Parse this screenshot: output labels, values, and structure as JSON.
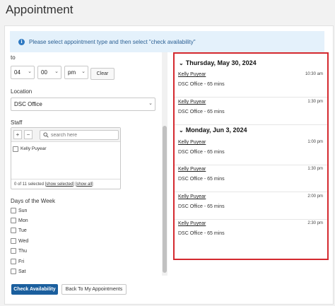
{
  "page": {
    "title": "Appointment"
  },
  "info": {
    "message": "Please select appointment type and then select \"check availability\""
  },
  "time_to": {
    "label": "to",
    "hour": "04",
    "minute": "00",
    "ampm": "pm",
    "clear_label": "Clear"
  },
  "location": {
    "label": "Location",
    "value": "DSC Office"
  },
  "staff": {
    "label": "Staff",
    "add": "+",
    "remove": "−",
    "search_placeholder": "search here",
    "members": [
      "Kelly Puyear"
    ],
    "selected_text": "0 of 11 selected [",
    "show_selected": "show selected",
    "sep": "] [",
    "show_all": "show all",
    "end": "]"
  },
  "days": {
    "label": "Days of the Week",
    "items": [
      "Sun",
      "Mon",
      "Tue",
      "Wed",
      "Thu",
      "Fri",
      "Sat"
    ]
  },
  "buttons": {
    "check_availability": "Check Availability",
    "back": "Back To My Appointments"
  },
  "availability": [
    {
      "date": "Thursday, May 30, 2024",
      "slots": [
        {
          "name": "Kelly Puyear",
          "location": "DSC Office - 65 mins",
          "time": "10:30 am"
        },
        {
          "name": "Kelly Puyear",
          "location": "DSC Office - 65 mins",
          "time": "1:30 pm"
        }
      ]
    },
    {
      "date": "Monday, Jun 3, 2024",
      "slots": [
        {
          "name": "Kelly Puyear",
          "location": "DSC Office - 65 mins",
          "time": "1:00 pm"
        },
        {
          "name": "Kelly Puyear",
          "location": "DSC Office - 65 mins",
          "time": "1:30 pm"
        },
        {
          "name": "Kelly Puyear",
          "location": "DSC Office - 65 mins",
          "time": "2:00 pm"
        },
        {
          "name": "Kelly Puyear",
          "location": "DSC Office - 65 mins",
          "time": "2:30 pm"
        }
      ]
    }
  ]
}
